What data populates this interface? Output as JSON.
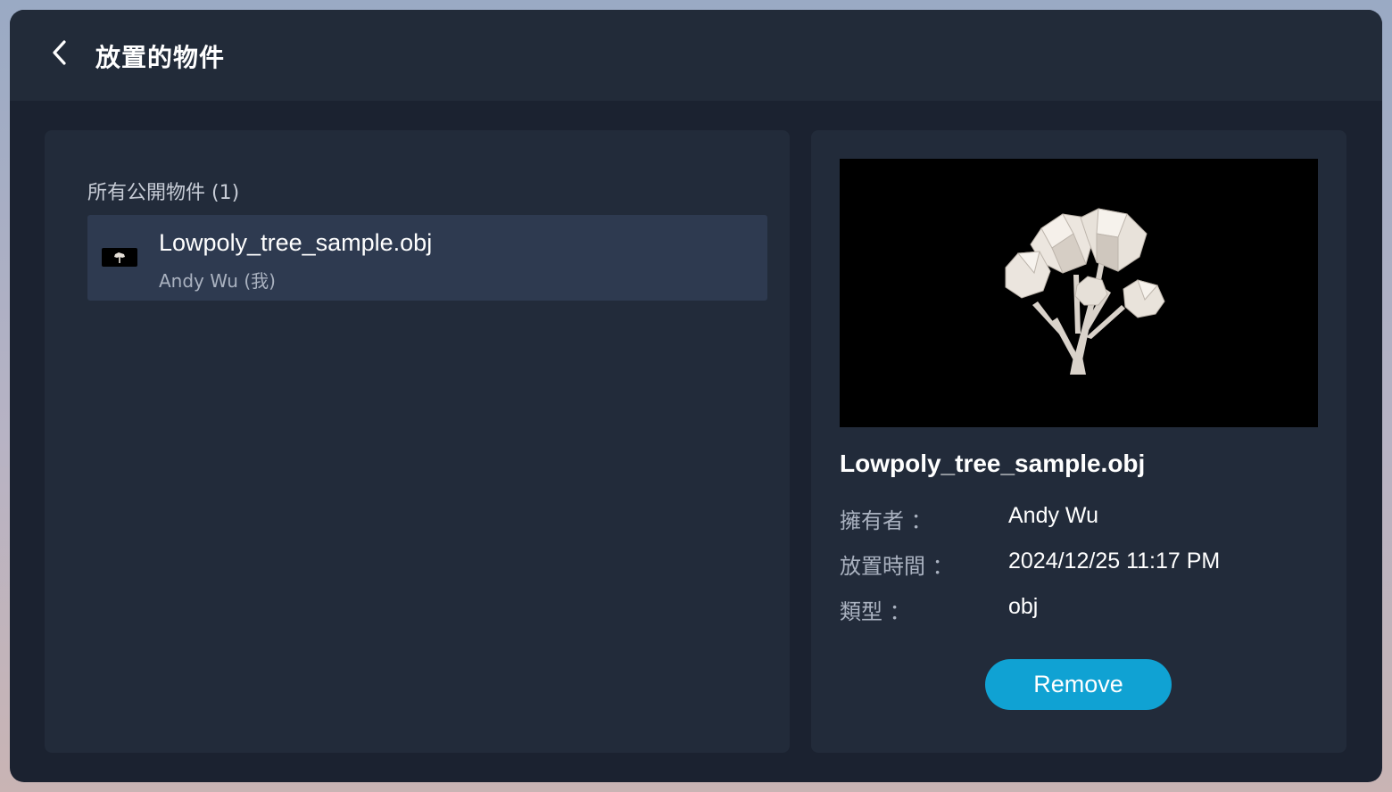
{
  "header": {
    "title": "放置的物件",
    "back_icon": "chevron-left-icon"
  },
  "list": {
    "section_label": "所有公開物件 (1)",
    "items": [
      {
        "name": "Lowpoly_tree_sample.obj",
        "owner": "Andy Wu (我)",
        "thumbnail_icon": "tree-thumbnail-icon"
      }
    ]
  },
  "details": {
    "preview_icon": "lowpoly-tree-preview",
    "name": "Lowpoly_tree_sample.obj",
    "rows": [
      {
        "label": "擁有者 ：",
        "value": "Andy Wu"
      },
      {
        "label": "放置時間 ：",
        "value": "2024/12/25 11:17 PM"
      },
      {
        "label": "類型 ：",
        "value": "obj"
      }
    ],
    "remove_label": "Remove"
  },
  "colors": {
    "accent": "#10a2d3",
    "window_bg": "#1b2230",
    "panel_bg": "#222b3a",
    "selected_item_bg": "#2e3a50"
  }
}
